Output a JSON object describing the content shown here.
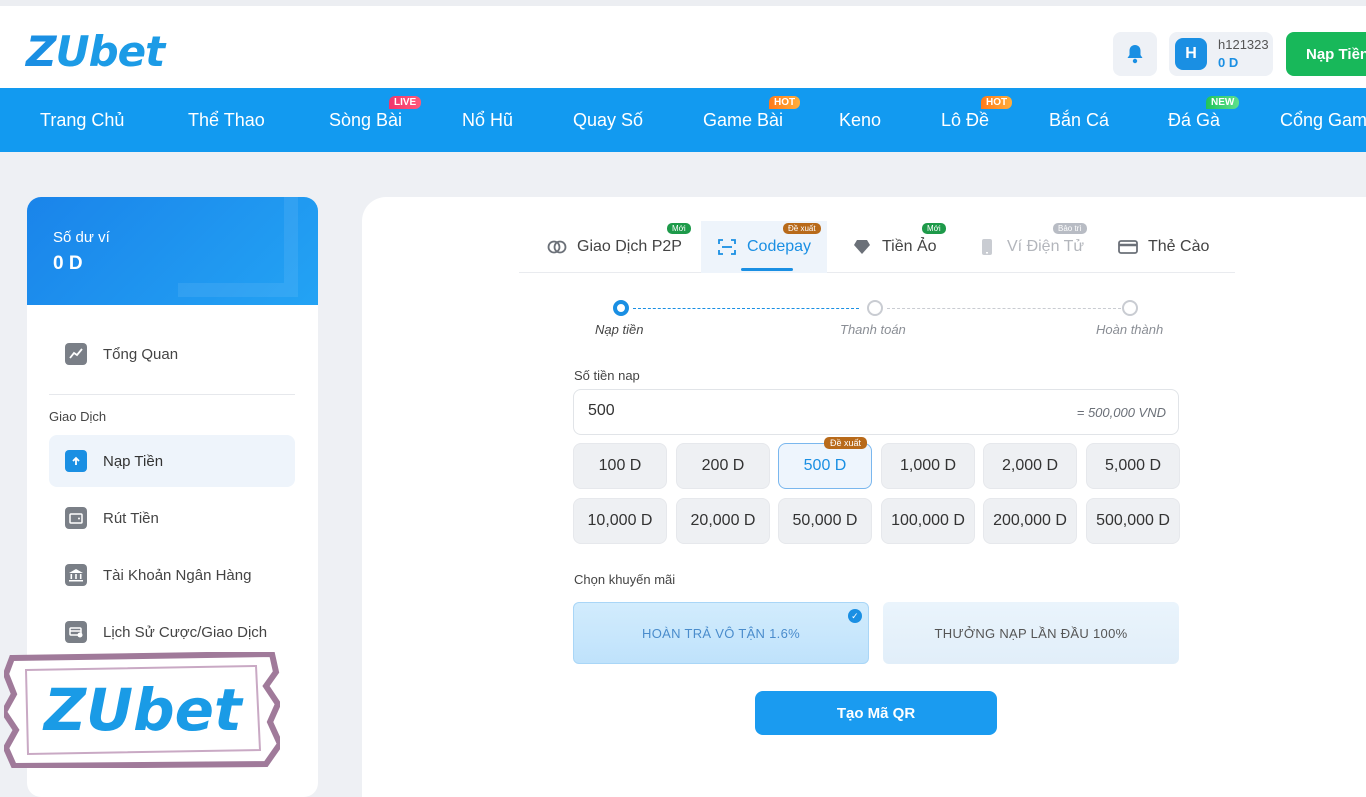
{
  "brand": {
    "logo_z": "Z",
    "logo_rest": "Ubet"
  },
  "header": {
    "username": "h121323",
    "balance": "0 D",
    "avatar_letter": "H",
    "deposit_label": "Nạp Tiền"
  },
  "nav": {
    "items": [
      {
        "label": "Trang Chủ",
        "tag": ""
      },
      {
        "label": "Thể Thao",
        "tag": ""
      },
      {
        "label": "Sòng Bài",
        "tag": "LIVE"
      },
      {
        "label": "Nổ Hũ",
        "tag": ""
      },
      {
        "label": "Quay Số",
        "tag": ""
      },
      {
        "label": "Game Bài",
        "tag": "HOT"
      },
      {
        "label": "Keno",
        "tag": ""
      },
      {
        "label": "Lô Đề",
        "tag": "HOT"
      },
      {
        "label": "Bắn Cá",
        "tag": ""
      },
      {
        "label": "Đá Gà",
        "tag": "NEW"
      },
      {
        "label": "Cổng Game",
        "tag": ""
      }
    ]
  },
  "sidebar": {
    "wallet_label": "Số dư ví",
    "wallet_amount": "0 D",
    "overview": "Tổng Quan",
    "group_label": "Giao Dịch",
    "items": [
      {
        "label": "Nạp Tiền",
        "active": true
      },
      {
        "label": "Rút Tiền",
        "active": false
      },
      {
        "label": "Tài Khoản Ngân Hàng",
        "active": false
      },
      {
        "label": "Lịch Sử Cược/Giao Dịch",
        "active": false
      }
    ]
  },
  "tabs": [
    {
      "label": "Giao Dịch P2P",
      "tag": "Mới"
    },
    {
      "label": "Codepay",
      "tag": "Đề xuất"
    },
    {
      "label": "Tiền Ảo",
      "tag": "Mới"
    },
    {
      "label": "Ví Điện Tử",
      "tag": "Bảo trì"
    },
    {
      "label": "Thẻ Cào",
      "tag": ""
    }
  ],
  "steps": [
    {
      "label": "Nạp tiền",
      "active": true
    },
    {
      "label": "Thanh toán",
      "active": false
    },
    {
      "label": "Hoàn thành",
      "active": false
    }
  ],
  "form": {
    "amount_label": "Số tiền nap",
    "amount_value": "500",
    "amount_converted": "= 500,000 VND",
    "chips": [
      "100 D",
      "200 D",
      "500 D",
      "1,000 D",
      "2,000 D",
      "5,000 D",
      "10,000 D",
      "20,000 D",
      "50,000 D",
      "100,000 D",
      "200,000 D",
      "500,000 D"
    ],
    "selected_chip_tag": "Đề xuất",
    "promo_label": "Chọn khuyến mãi",
    "promos": [
      {
        "label": "HOÀN TRẢ VÔ TẬN 1.6%",
        "selected": true
      },
      {
        "label": "THƯỞNG NẠP LẦN ĐẦU 100%",
        "selected": false
      }
    ],
    "submit_label": "Tạo Mã QR"
  },
  "colors": {
    "primary": "#1a8fe3",
    "nav": "#129af0",
    "green": "#18b85a"
  }
}
